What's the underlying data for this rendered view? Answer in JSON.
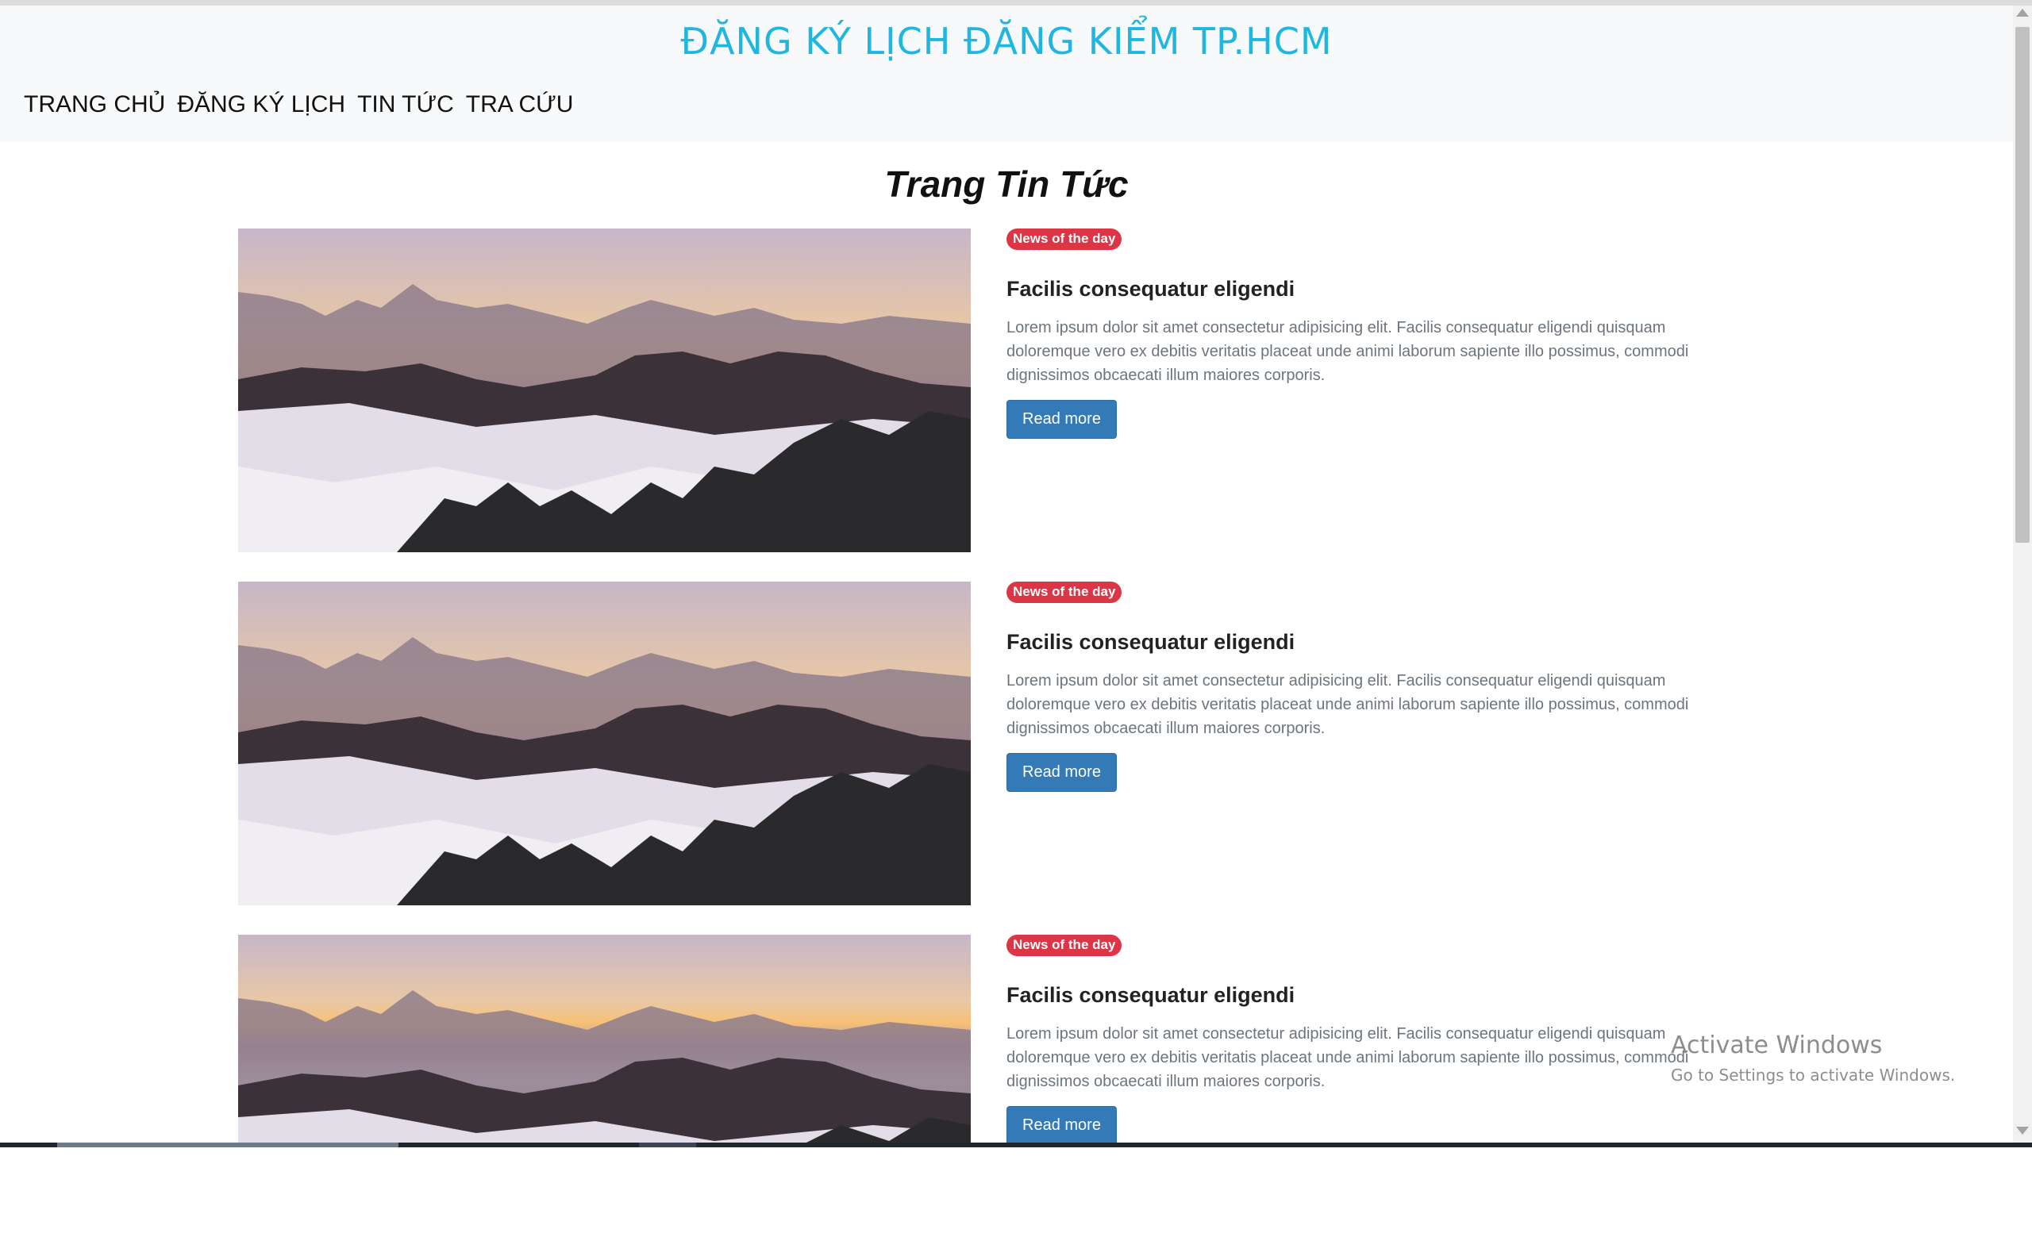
{
  "header": {
    "title": "ĐĂNG KÝ LỊCH ĐĂNG KIỂM TP.HCM",
    "nav": [
      "TRANG CHỦ",
      "ĐĂNG KÝ LỊCH",
      "TIN TỨC",
      "TRA CỨU"
    ]
  },
  "page": {
    "heading": "Trang Tin Tức"
  },
  "articles": [
    {
      "badge": "News of the day",
      "title": "Facilis consequatur eligendi",
      "text": "Lorem ipsum dolor sit amet consectetur adipisicing elit. Facilis consequatur eligendi quisquam doloremque vero ex debitis veritatis placeat unde animi laborum sapiente illo possimus, commodi dignissimos obcaecati illum maiores corporis.",
      "button": "Read more"
    },
    {
      "badge": "News of the day",
      "title": "Facilis consequatur eligendi",
      "text": "Lorem ipsum dolor sit amet consectetur adipisicing elit. Facilis consequatur eligendi quisquam doloremque vero ex debitis veritatis placeat unde animi laborum sapiente illo possimus, commodi dignissimos obcaecati illum maiores corporis.",
      "button": "Read more"
    },
    {
      "badge": "News of the day",
      "title": "Facilis consequatur eligendi",
      "text": "Lorem ipsum dolor sit amet consectetur adipisicing elit. Facilis consequatur eligendi quisquam doloremque vero ex debitis veritatis placeat unde animi laborum sapiente illo possimus, commodi dignissimos obcaecati illum maiores corporis.",
      "button": "Read more"
    }
  ],
  "watermark": {
    "title": "Activate Windows",
    "subtitle": "Go to Settings to activate Windows."
  },
  "colors": {
    "title": "#1fb6e0",
    "badge": "#dc3545",
    "button": "#337ab7",
    "header_bg": "#f8f9fa"
  }
}
